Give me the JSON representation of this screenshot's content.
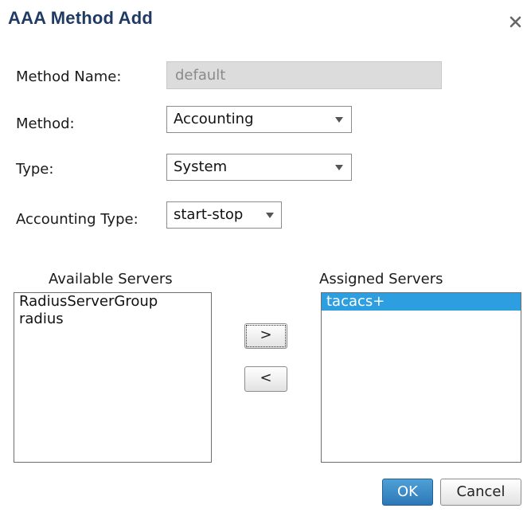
{
  "dialog": {
    "title": "AAA Method Add",
    "close_icon": "close-icon"
  },
  "form": {
    "method_name_label": "Method Name:",
    "method_name_value": "default",
    "method_label": "Method:",
    "method_value": "Accounting",
    "type_label": "Type:",
    "type_value": "System",
    "accounting_type_label": "Accounting Type:",
    "accounting_type_value": "start-stop"
  },
  "servers": {
    "available_title": "Available Servers",
    "available": [
      "RadiusServerGroup",
      "radius"
    ],
    "assigned_title": "Assigned Servers",
    "assigned": [
      "tacacs+"
    ],
    "assigned_selected": "tacacs+",
    "add_label": ">",
    "remove_label": "<"
  },
  "actions": {
    "ok_label": "OK",
    "cancel_label": "Cancel"
  },
  "colors": {
    "title": "#1f3b63",
    "selection": "#2d9fe0",
    "ok_button": "#2c78b8",
    "disabled_input": "#dcdcdc"
  }
}
